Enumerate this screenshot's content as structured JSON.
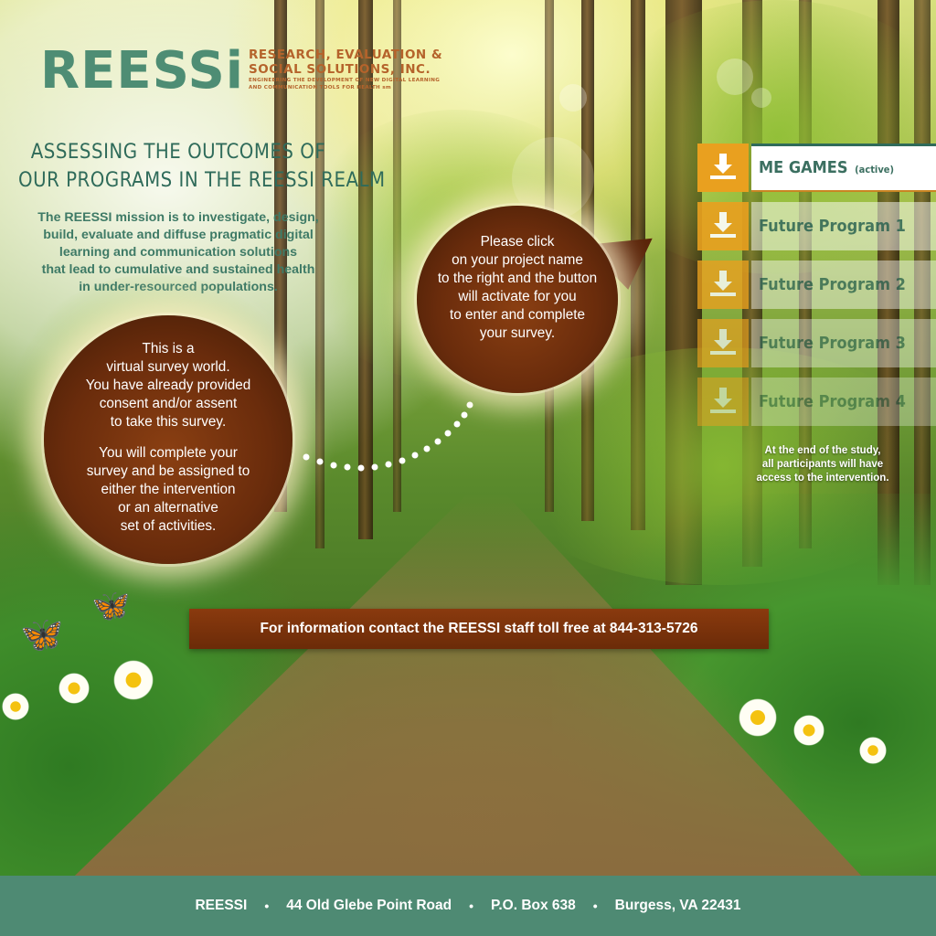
{
  "logo": {
    "mark": "REESSi",
    "name_line1": "RESEARCH, EVALUATION &",
    "name_line2": "SOCIAL SOLUTIONS, INC.",
    "tagline_line1": "ENGINEERING THE DEVELOPMENT OF NEW DIGITAL LEARNING",
    "tagline_line2": "AND COMMUNICATION TOOLS FOR HEALTH sm"
  },
  "heading": {
    "line1": "ASSESSING THE OUTCOMES OF",
    "line2": "OUR PROGRAMS IN THE REESSI REALM"
  },
  "mission": [
    "The REESSI mission is to investigate, design,",
    "build, evaluate and diffuse pragmatic digital",
    "learning and communication solutions",
    "that lead to cumulative and sustained health",
    "in under-resourced populations."
  ],
  "bubble_left": {
    "para1": [
      "This is a",
      "virtual survey world.",
      "You have already provided",
      "consent and/or assent",
      "to take this survey."
    ],
    "para2": [
      "You will complete your",
      "survey and be assigned to",
      "either the intervention",
      "or an alternative",
      "set of activities."
    ]
  },
  "bubble_right": [
    "Please click",
    "on your project name",
    "to the right and the button",
    "will activate for you",
    "to enter and complete",
    "your survey."
  ],
  "programs": [
    {
      "label": "ME GAMES",
      "tag": "(active)"
    },
    {
      "label": "Future Program 1"
    },
    {
      "label": "Future Program 2"
    },
    {
      "label": "Future Program 3"
    },
    {
      "label": "Future Program 4"
    }
  ],
  "end_note": [
    "At the end of the study,",
    "all participants will have",
    "access to the intervention."
  ],
  "contact": "For information contact the REESSI staff toll free at 844-313-5726",
  "footer": {
    "org": "REESSI",
    "sep": "•",
    "address": "44 Old Glebe Point Road",
    "po_box": "P.O. Box 638",
    "city": "Burgess, VA 22431"
  },
  "colors": {
    "brand_green": "#4e8a73",
    "brand_orange": "#b5632b",
    "button_gold": "#e9a01f",
    "bubble_brown": "#6a2c0c"
  },
  "icons": [
    "download-icon",
    "butterfly-icon",
    "daisy-icon"
  ]
}
